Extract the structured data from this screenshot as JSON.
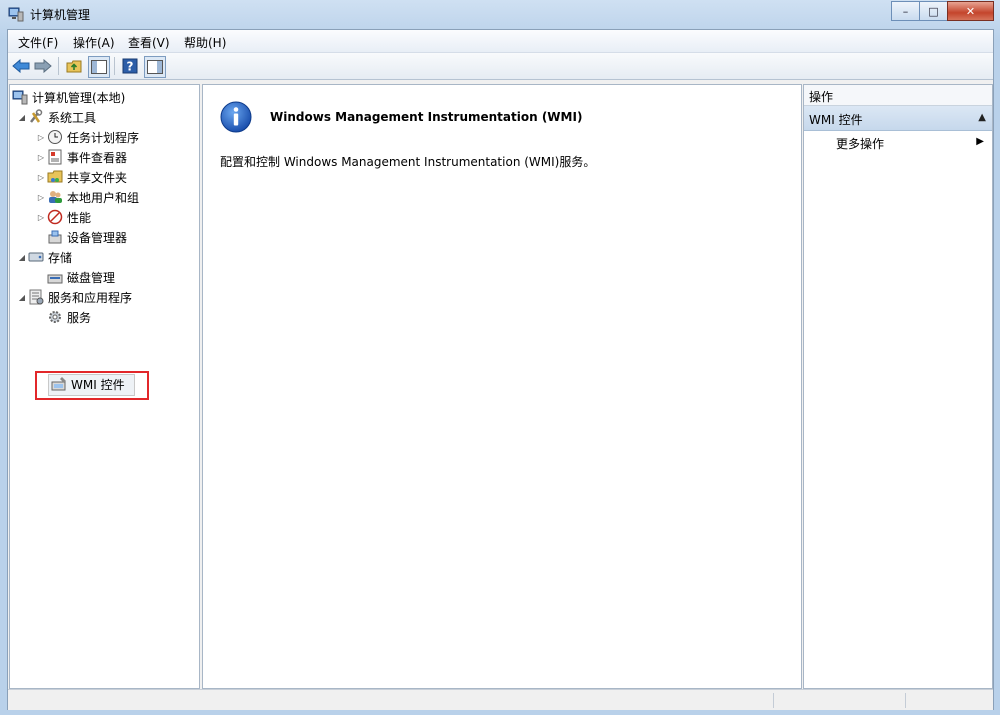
{
  "window": {
    "title": "计算机管理"
  },
  "menu": [
    {
      "label": "文件(F)"
    },
    {
      "label": "操作(A)"
    },
    {
      "label": "查看(V)"
    },
    {
      "label": "帮助(H)"
    }
  ],
  "toolbar": {
    "icons": [
      "back-arrow-icon",
      "forward-arrow-icon",
      "up-folder-icon",
      "show-hide-tree-icon",
      "help-icon",
      "show-hide-action-pane-icon"
    ]
  },
  "tree": {
    "root": "计算机管理(本地)",
    "system_tools": "系统工具",
    "task_scheduler": "任务计划程序",
    "event_viewer": "事件查看器",
    "shared_folders": "共享文件夹",
    "local_users": "本地用户和组",
    "performance": "性能",
    "device_manager": "设备管理器",
    "storage": "存储",
    "disk_management": "磁盘管理",
    "services_apps": "服务和应用程序",
    "services": "服务",
    "wmi_control": "WMI 控件"
  },
  "center": {
    "title": "Windows Management Instrumentation (WMI)",
    "description": "配置和控制 Windows Management Instrumentation (WMI)服务。"
  },
  "actions": {
    "header": "操作",
    "section": "WMI 控件",
    "more": "更多操作"
  },
  "colors": {
    "highlight_border": "#e2272a",
    "info_blue": "#1f5fbf",
    "action_section_bg": "#c6d8ec"
  }
}
